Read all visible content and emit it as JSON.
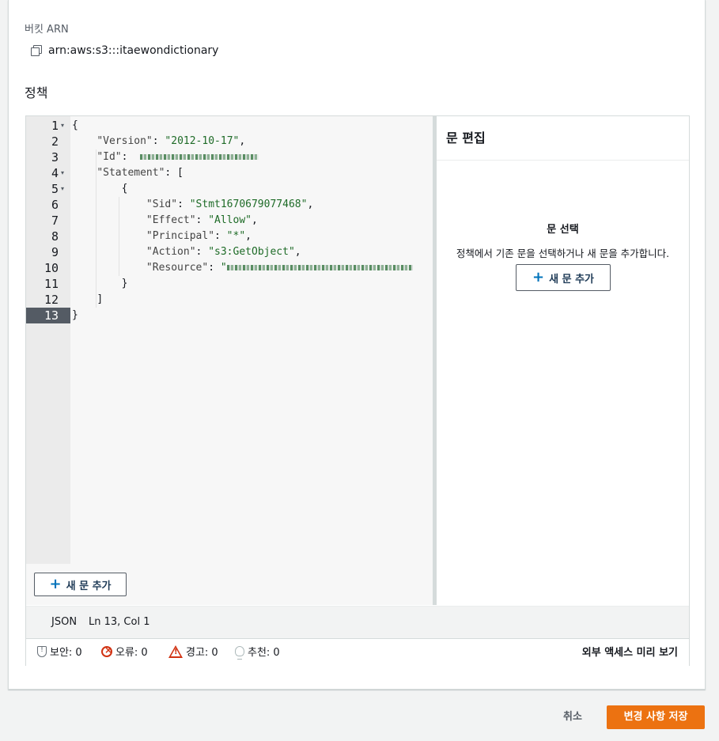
{
  "bucket": {
    "arn_label": "버킷 ARN",
    "arn_value": "arn:aws:s3:::itaewondictionary"
  },
  "policy": {
    "title": "정책",
    "line_numbers": [
      "1",
      "2",
      "3",
      "4",
      "5",
      "6",
      "7",
      "8",
      "9",
      "10",
      "11",
      "12",
      "13"
    ],
    "code": {
      "l1": "{",
      "l2_key": "\"Version\"",
      "l2_val": "\"2012-10-17\"",
      "l3_key": "\"Id\"",
      "l4_key": "\"Statement\"",
      "l4_rest": ": [",
      "l5": "{",
      "l6_key": "\"Sid\"",
      "l6_val": "\"Stmt1670679077468\"",
      "l7_key": "\"Effect\"",
      "l7_val": "\"Allow\"",
      "l8_key": "\"Principal\"",
      "l8_val": "\"*\"",
      "l9_key": "\"Action\"",
      "l9_val": "\"s3:GetObject\"",
      "l10_key": "\"Resource\"",
      "l11": "}",
      "l12": "]",
      "l13": "}"
    },
    "add_statement_label": "새 문 추가"
  },
  "side_panel": {
    "title": "문 편집",
    "select_title": "문 선택",
    "select_desc": "정책에서 기존 문을 선택하거나 새 문을 추가합니다.",
    "add_statement_label": "새 문 추가"
  },
  "status": {
    "mode": "JSON",
    "position": "Ln 13, Col 1"
  },
  "issues": {
    "security": "보안: 0",
    "errors": "오류: 0",
    "warnings": "경고: 0",
    "suggestions": "추천: 0",
    "preview_label": "외부 액세스 미리 보기"
  },
  "footer": {
    "cancel_label": "취소",
    "save_label": "변경 사항 저장"
  },
  "colors": {
    "primary_button": "#ec7211",
    "error": "#d13212",
    "accent": "#0073bb"
  }
}
